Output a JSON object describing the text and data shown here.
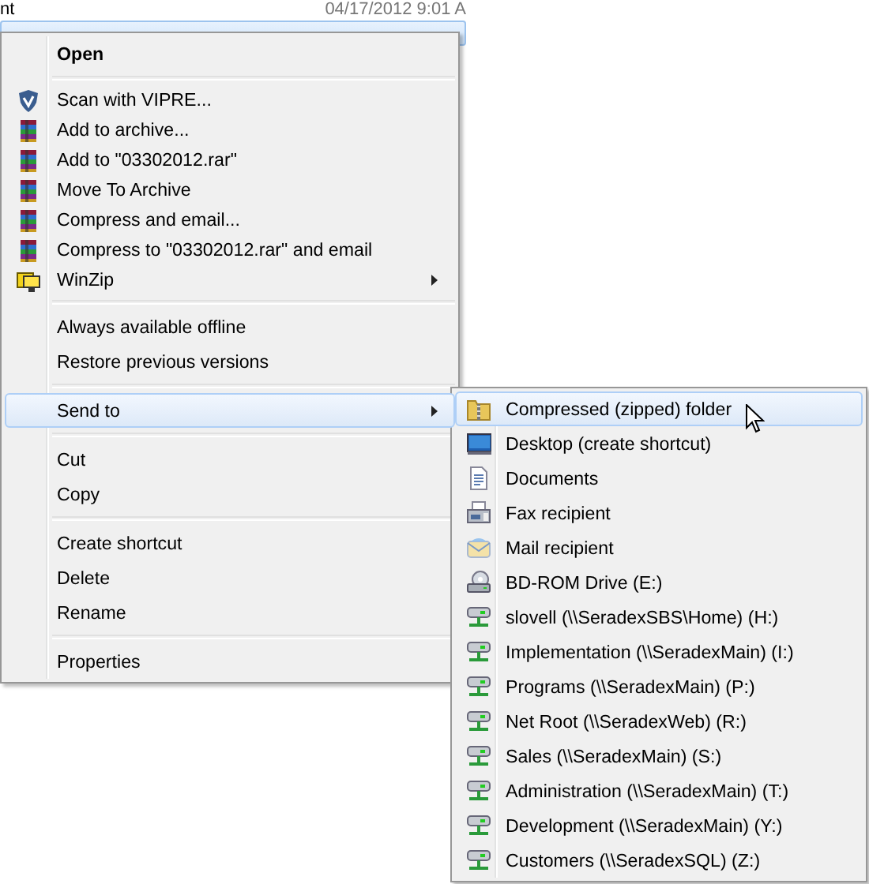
{
  "file_list": {
    "rows": [
      {
        "name": "nt",
        "modified": "04/17/2012 9:01 A",
        "selected": false
      },
      {
        "selected": true
      }
    ]
  },
  "context_menu": {
    "groups": [
      {
        "items": [
          {
            "label": "Open",
            "kind": "plain",
            "bold": true,
            "submenu": false,
            "selected": false
          }
        ]
      },
      {
        "items": [
          {
            "label": "Scan with VIPRE...",
            "kind": "shield",
            "bold": false,
            "submenu": false,
            "selected": false
          },
          {
            "label": "Add to archive...",
            "kind": "archive",
            "bold": false,
            "submenu": false,
            "selected": false
          },
          {
            "label": "Add to \"03302012.rar\"",
            "kind": "archive",
            "bold": false,
            "submenu": false,
            "selected": false
          },
          {
            "label": "Move To Archive",
            "kind": "archive",
            "bold": false,
            "submenu": false,
            "selected": false
          },
          {
            "label": "Compress and email...",
            "kind": "archive",
            "bold": false,
            "submenu": false,
            "selected": false
          },
          {
            "label": "Compress to \"03302012.rar\" and email",
            "kind": "archive",
            "bold": false,
            "submenu": false,
            "selected": false
          },
          {
            "label": "WinZip",
            "kind": "winzip",
            "bold": false,
            "submenu": true,
            "selected": false
          }
        ]
      },
      {
        "items": [
          {
            "label": "Always available offline",
            "kind": "plain",
            "bold": false,
            "submenu": false,
            "selected": false
          },
          {
            "label": "Restore previous versions",
            "kind": "plain",
            "bold": false,
            "submenu": false,
            "selected": false
          }
        ]
      },
      {
        "items": [
          {
            "label": "Send to",
            "kind": "plain",
            "bold": false,
            "submenu": true,
            "selected": true
          }
        ]
      },
      {
        "items": [
          {
            "label": "Cut",
            "kind": "plain",
            "bold": false,
            "submenu": false,
            "selected": false
          },
          {
            "label": "Copy",
            "kind": "plain",
            "bold": false,
            "submenu": false,
            "selected": false
          }
        ]
      },
      {
        "items": [
          {
            "label": "Create shortcut",
            "kind": "plain",
            "bold": false,
            "submenu": false,
            "selected": false
          },
          {
            "label": "Delete",
            "kind": "plain",
            "bold": false,
            "submenu": false,
            "selected": false
          },
          {
            "label": "Rename",
            "kind": "plain",
            "bold": false,
            "submenu": false,
            "selected": false
          }
        ]
      },
      {
        "items": [
          {
            "label": "Properties",
            "kind": "plain",
            "bold": false,
            "submenu": false,
            "selected": false
          }
        ]
      }
    ]
  },
  "send_to_menu": {
    "items": [
      {
        "label": "Compressed (zipped) folder",
        "kind": "zip-folder",
        "selected": true
      },
      {
        "label": "Desktop (create shortcut)",
        "kind": "desktop",
        "selected": false
      },
      {
        "label": "Documents",
        "kind": "document",
        "selected": false
      },
      {
        "label": "Fax recipient",
        "kind": "fax",
        "selected": false
      },
      {
        "label": "Mail recipient",
        "kind": "mail",
        "selected": false
      },
      {
        "label": "BD-ROM Drive (E:)",
        "kind": "drive",
        "selected": false
      },
      {
        "label": "slovell (\\\\SeradexSBS\\Home) (H:)",
        "kind": "network",
        "selected": false
      },
      {
        "label": "Implementation (\\\\SeradexMain) (I:)",
        "kind": "network",
        "selected": false
      },
      {
        "label": "Programs (\\\\SeradexMain) (P:)",
        "kind": "network",
        "selected": false
      },
      {
        "label": "Net Root (\\\\SeradexWeb) (R:)",
        "kind": "network",
        "selected": false
      },
      {
        "label": "Sales (\\\\SeradexMain) (S:)",
        "kind": "network",
        "selected": false
      },
      {
        "label": "Administration (\\\\SeradexMain) (T:)",
        "kind": "network",
        "selected": false
      },
      {
        "label": "Development (\\\\SeradexMain) (Y:)",
        "kind": "network",
        "selected": false
      },
      {
        "label": "Customers (\\\\SeradexSQL) (Z:)",
        "kind": "network",
        "selected": false
      }
    ]
  }
}
